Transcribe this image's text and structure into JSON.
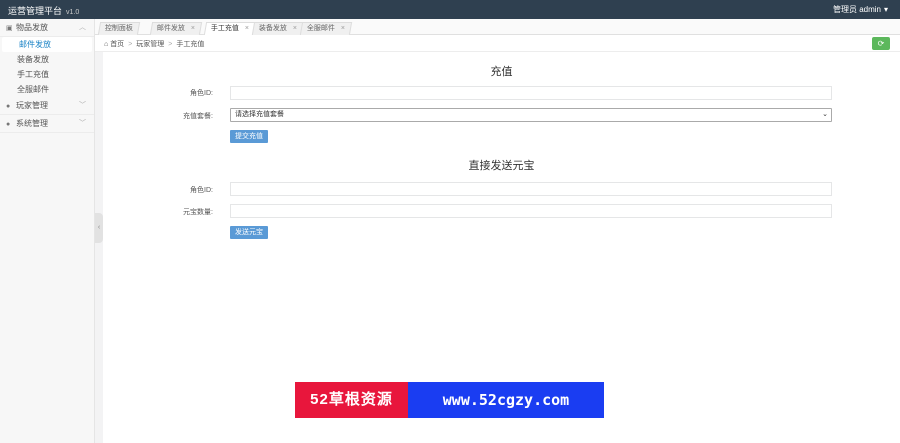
{
  "app": {
    "title": "运营管理平台",
    "version": "v1.0"
  },
  "user": {
    "prefix": "管理员",
    "name": "admin",
    "caret": "▾"
  },
  "sidebar": {
    "groups": [
      {
        "label": "物品发放",
        "icon": "gift-icon",
        "expanded": true,
        "items": [
          {
            "label": "邮件发放",
            "active": true
          },
          {
            "label": "装备发放",
            "active": false
          },
          {
            "label": "手工充值",
            "active": false
          },
          {
            "label": "全服邮件",
            "active": false
          }
        ]
      },
      {
        "label": "玩家管理",
        "icon": "user-icon",
        "expanded": false,
        "items": []
      },
      {
        "label": "系统管理",
        "icon": "gear-icon",
        "expanded": false,
        "items": []
      }
    ]
  },
  "tabs": [
    {
      "label": "控制面板",
      "active": false
    },
    {
      "label": "邮件发放",
      "active": false
    },
    {
      "label": "手工充值",
      "active": true
    },
    {
      "label": "装备发放",
      "active": false
    },
    {
      "label": "全服邮件",
      "active": false
    }
  ],
  "breadcrumb": {
    "home": "首页",
    "parent": "玩家管理",
    "current": "手工充值"
  },
  "recharge": {
    "title": "充值",
    "role_id_label": "角色ID:",
    "role_id_value": "",
    "package_label": "充值套餐:",
    "package_selected": "请选择充值套餐",
    "submit_label": "提交充值"
  },
  "send_yuanbao": {
    "title": "直接发送元宝",
    "role_id_label": "角色ID:",
    "role_id_value": "",
    "amount_label": "元宝数量:",
    "amount_value": "",
    "submit_label": "发送元宝"
  },
  "watermark": {
    "left": "52草根资源",
    "right": "www.52cgzy.com"
  },
  "colors": {
    "topbar": "#2f4050",
    "refresh": "#5cb85c",
    "button": "#5a9ad6",
    "watermark_red": "#e8163c",
    "watermark_blue": "#1a3df2"
  }
}
